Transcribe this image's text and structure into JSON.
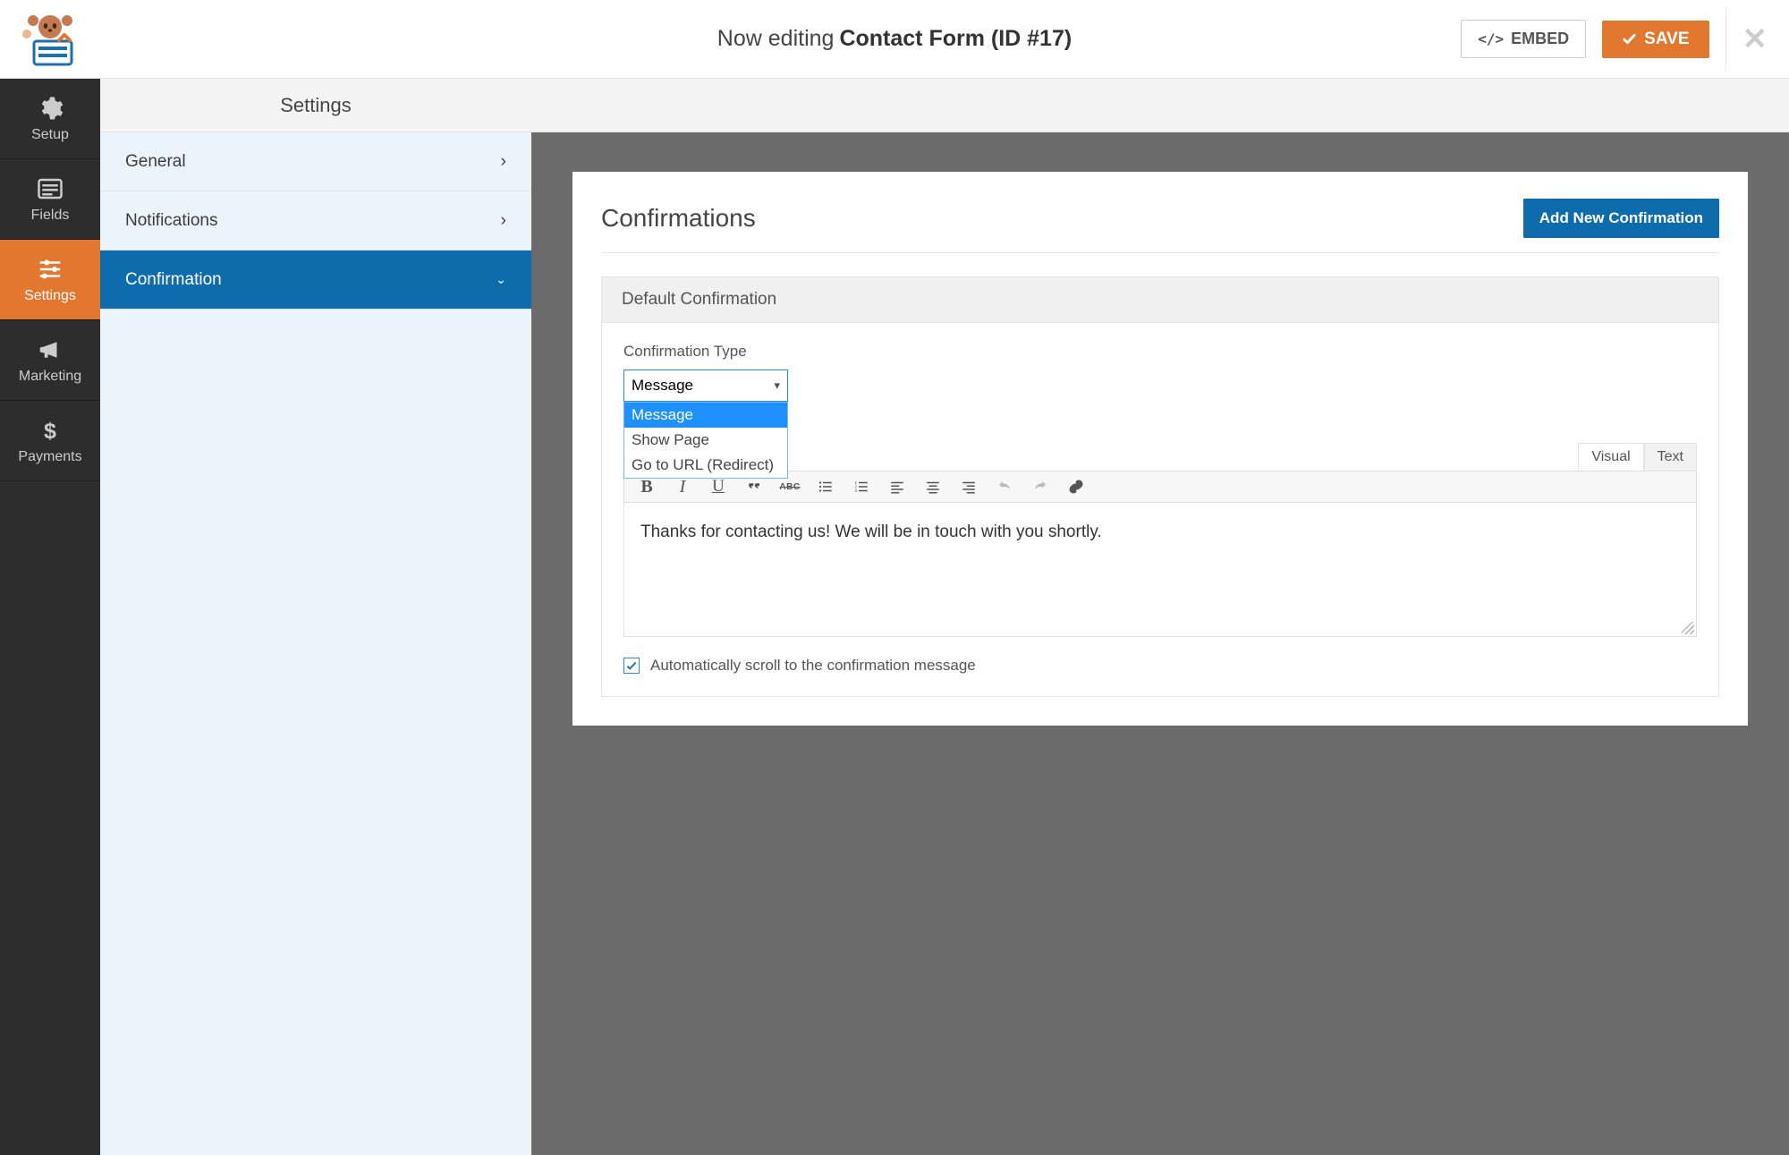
{
  "topbar": {
    "now_editing_prefix": "Now editing",
    "form_name": "Contact Form (ID #17)",
    "embed_label": "EMBED",
    "save_label": "SAVE"
  },
  "sidebar": {
    "items": [
      {
        "label": "Setup"
      },
      {
        "label": "Fields"
      },
      {
        "label": "Settings"
      },
      {
        "label": "Marketing"
      },
      {
        "label": "Payments"
      }
    ],
    "active_index": 2
  },
  "panel_title": "Settings",
  "settings_nav": {
    "active_index": 2,
    "items": [
      {
        "label": "General"
      },
      {
        "label": "Notifications"
      },
      {
        "label": "Confirmation"
      }
    ]
  },
  "confirmations": {
    "heading": "Confirmations",
    "add_button": "Add New Confirmation",
    "box_title": "Default Confirmation",
    "type_label": "Confirmation Type",
    "type_selected": "Message",
    "type_options": [
      "Message",
      "Show Page",
      "Go to URL (Redirect)"
    ],
    "type_highlight_index": 0,
    "editor_tabs": {
      "visual": "Visual",
      "text": "Text",
      "active": "visual"
    },
    "message_value": "Thanks for contacting us! We will be in touch with you shortly.",
    "auto_scroll_checked": true,
    "auto_scroll_label": "Automatically scroll to the confirmation message"
  },
  "colors": {
    "accent_orange": "#e27730",
    "accent_blue": "#0e6cad"
  }
}
